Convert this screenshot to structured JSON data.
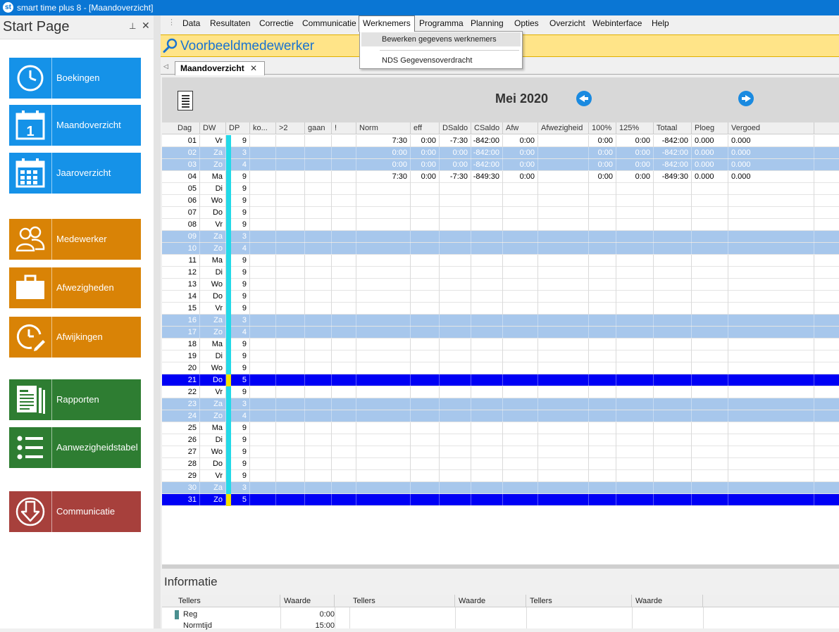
{
  "window": {
    "title": "smart time plus 8 - [Maandoverzicht]"
  },
  "start_page": {
    "title": "Start Page",
    "pin_icon": "pin-icon",
    "tiles": [
      {
        "label": "Boekingen",
        "icon": "clock-icon",
        "color": "#1592e8"
      },
      {
        "label": "Maandoverzicht",
        "icon": "calendar-day-icon",
        "color": "#1592e8"
      },
      {
        "label": "Jaaroverzicht",
        "icon": "calendar-grid-icon",
        "color": "#1592e8"
      },
      {
        "label": "Medewerker",
        "icon": "people-icon",
        "color": "#d98306"
      },
      {
        "label": "Afwezigheden",
        "icon": "briefcase-icon",
        "color": "#d98306"
      },
      {
        "label": "Afwijkingen",
        "icon": "clock-edit-icon",
        "color": "#d98306"
      },
      {
        "label": "Rapporten",
        "icon": "report-icon",
        "color": "#2e7d32"
      },
      {
        "label": "Aanwezigheidstabel",
        "icon": "list-icon",
        "color": "#2e7d32"
      },
      {
        "label": "Communicatie",
        "icon": "download-icon",
        "color": "#a7403c"
      }
    ]
  },
  "menu": {
    "items": [
      "Data",
      "Resultaten",
      "Correctie",
      "Communicatie",
      "Werknemers",
      "Programma",
      "Planning",
      "Opties",
      "Overzicht",
      "Webinterface",
      "Help"
    ],
    "active": "Werknemers",
    "dropdown": [
      "Bewerken gegevens werknemers",
      "NDS Gegevensoverdracht"
    ]
  },
  "employee": {
    "name": "Voorbeeldmedewerker",
    "icon": "search-icon"
  },
  "tab": {
    "label": "Maandoverzicht",
    "close": "✕"
  },
  "month": {
    "title": "Mei 2020",
    "prev_icon": "arrow-left-icon",
    "next_icon": "arrow-right-icon",
    "list_icon": "list-view-icon"
  },
  "columns": [
    "Dag",
    "DW",
    "DP",
    "ko...",
    ">2",
    "gaan",
    "!",
    "Norm",
    "eff",
    "DSaldo",
    "CSaldo",
    "Afw",
    "Afwezigheid",
    "100%",
    "125%",
    "Totaal",
    "Ploeg",
    "Vergoed"
  ],
  "rows": [
    {
      "dag": "01",
      "dw": "Vr",
      "dp": "9",
      "type": "work",
      "norm": "7:30",
      "eff": "0:00",
      "dsaldo": "-7:30",
      "csaldo": "-842:00",
      "afw": "0:00",
      "p100": "0:00",
      "p125": "0:00",
      "totaal": "-842:00",
      "ploeg": "0.000",
      "vergoed": "0.000"
    },
    {
      "dag": "02",
      "dw": "Za",
      "dp": "3",
      "type": "weekend",
      "norm": "0:00",
      "eff": "0:00",
      "dsaldo": "0:00",
      "csaldo": "-842:00",
      "afw": "0:00",
      "p100": "0:00",
      "p125": "0:00",
      "totaal": "-842:00",
      "ploeg": "0.000",
      "vergoed": "0.000"
    },
    {
      "dag": "03",
      "dw": "Zo",
      "dp": "4",
      "type": "weekend",
      "norm": "0:00",
      "eff": "0:00",
      "dsaldo": "0:00",
      "csaldo": "-842:00",
      "afw": "0:00",
      "p100": "0:00",
      "p125": "0:00",
      "totaal": "-842:00",
      "ploeg": "0.000",
      "vergoed": "0.000"
    },
    {
      "dag": "04",
      "dw": "Ma",
      "dp": "9",
      "type": "work",
      "norm": "7:30",
      "eff": "0:00",
      "dsaldo": "-7:30",
      "csaldo": "-849:30",
      "afw": "0:00",
      "p100": "0:00",
      "p125": "0:00",
      "totaal": "-849:30",
      "ploeg": "0.000",
      "vergoed": "0.000"
    },
    {
      "dag": "05",
      "dw": "Di",
      "dp": "9",
      "type": "work"
    },
    {
      "dag": "06",
      "dw": "Wo",
      "dp": "9",
      "type": "work"
    },
    {
      "dag": "07",
      "dw": "Do",
      "dp": "9",
      "type": "work"
    },
    {
      "dag": "08",
      "dw": "Vr",
      "dp": "9",
      "type": "work"
    },
    {
      "dag": "09",
      "dw": "Za",
      "dp": "3",
      "type": "weekend"
    },
    {
      "dag": "10",
      "dw": "Zo",
      "dp": "4",
      "type": "weekend"
    },
    {
      "dag": "11",
      "dw": "Ma",
      "dp": "9",
      "type": "work"
    },
    {
      "dag": "12",
      "dw": "Di",
      "dp": "9",
      "type": "work"
    },
    {
      "dag": "13",
      "dw": "Wo",
      "dp": "9",
      "type": "work"
    },
    {
      "dag": "14",
      "dw": "Do",
      "dp": "9",
      "type": "work"
    },
    {
      "dag": "15",
      "dw": "Vr",
      "dp": "9",
      "type": "work"
    },
    {
      "dag": "16",
      "dw": "Za",
      "dp": "3",
      "type": "weekend"
    },
    {
      "dag": "17",
      "dw": "Zo",
      "dp": "4",
      "type": "weekend"
    },
    {
      "dag": "18",
      "dw": "Ma",
      "dp": "9",
      "type": "work"
    },
    {
      "dag": "19",
      "dw": "Di",
      "dp": "9",
      "type": "work"
    },
    {
      "dag": "20",
      "dw": "Wo",
      "dp": "9",
      "type": "work"
    },
    {
      "dag": "21",
      "dw": "Do",
      "dp": "5",
      "type": "holiday"
    },
    {
      "dag": "22",
      "dw": "Vr",
      "dp": "9",
      "type": "work"
    },
    {
      "dag": "23",
      "dw": "Za",
      "dp": "3",
      "type": "weekend"
    },
    {
      "dag": "24",
      "dw": "Zo",
      "dp": "4",
      "type": "weekend"
    },
    {
      "dag": "25",
      "dw": "Ma",
      "dp": "9",
      "type": "work"
    },
    {
      "dag": "26",
      "dw": "Di",
      "dp": "9",
      "type": "work"
    },
    {
      "dag": "27",
      "dw": "Wo",
      "dp": "9",
      "type": "work"
    },
    {
      "dag": "28",
      "dw": "Do",
      "dp": "9",
      "type": "work"
    },
    {
      "dag": "29",
      "dw": "Vr",
      "dp": "9",
      "type": "work"
    },
    {
      "dag": "30",
      "dw": "Za",
      "dp": "3",
      "type": "weekend"
    },
    {
      "dag": "31",
      "dw": "Zo",
      "dp": "5",
      "type": "holiday"
    }
  ],
  "row_colors": {
    "weekend": "#a7c7ec",
    "holiday": "#0000f5",
    "dp_bar_normal": "#23d9e8",
    "dp_bar_holiday": "#f3e000"
  },
  "info": {
    "title": "Informatie",
    "headers": [
      "Tellers",
      "Waarde",
      "Tellers",
      "Waarde",
      "Tellers",
      "Waarde"
    ],
    "rows": [
      {
        "teller": "Reg",
        "waarde": "0:00"
      },
      {
        "teller": "Normtijd",
        "waarde": "15:00"
      }
    ]
  }
}
